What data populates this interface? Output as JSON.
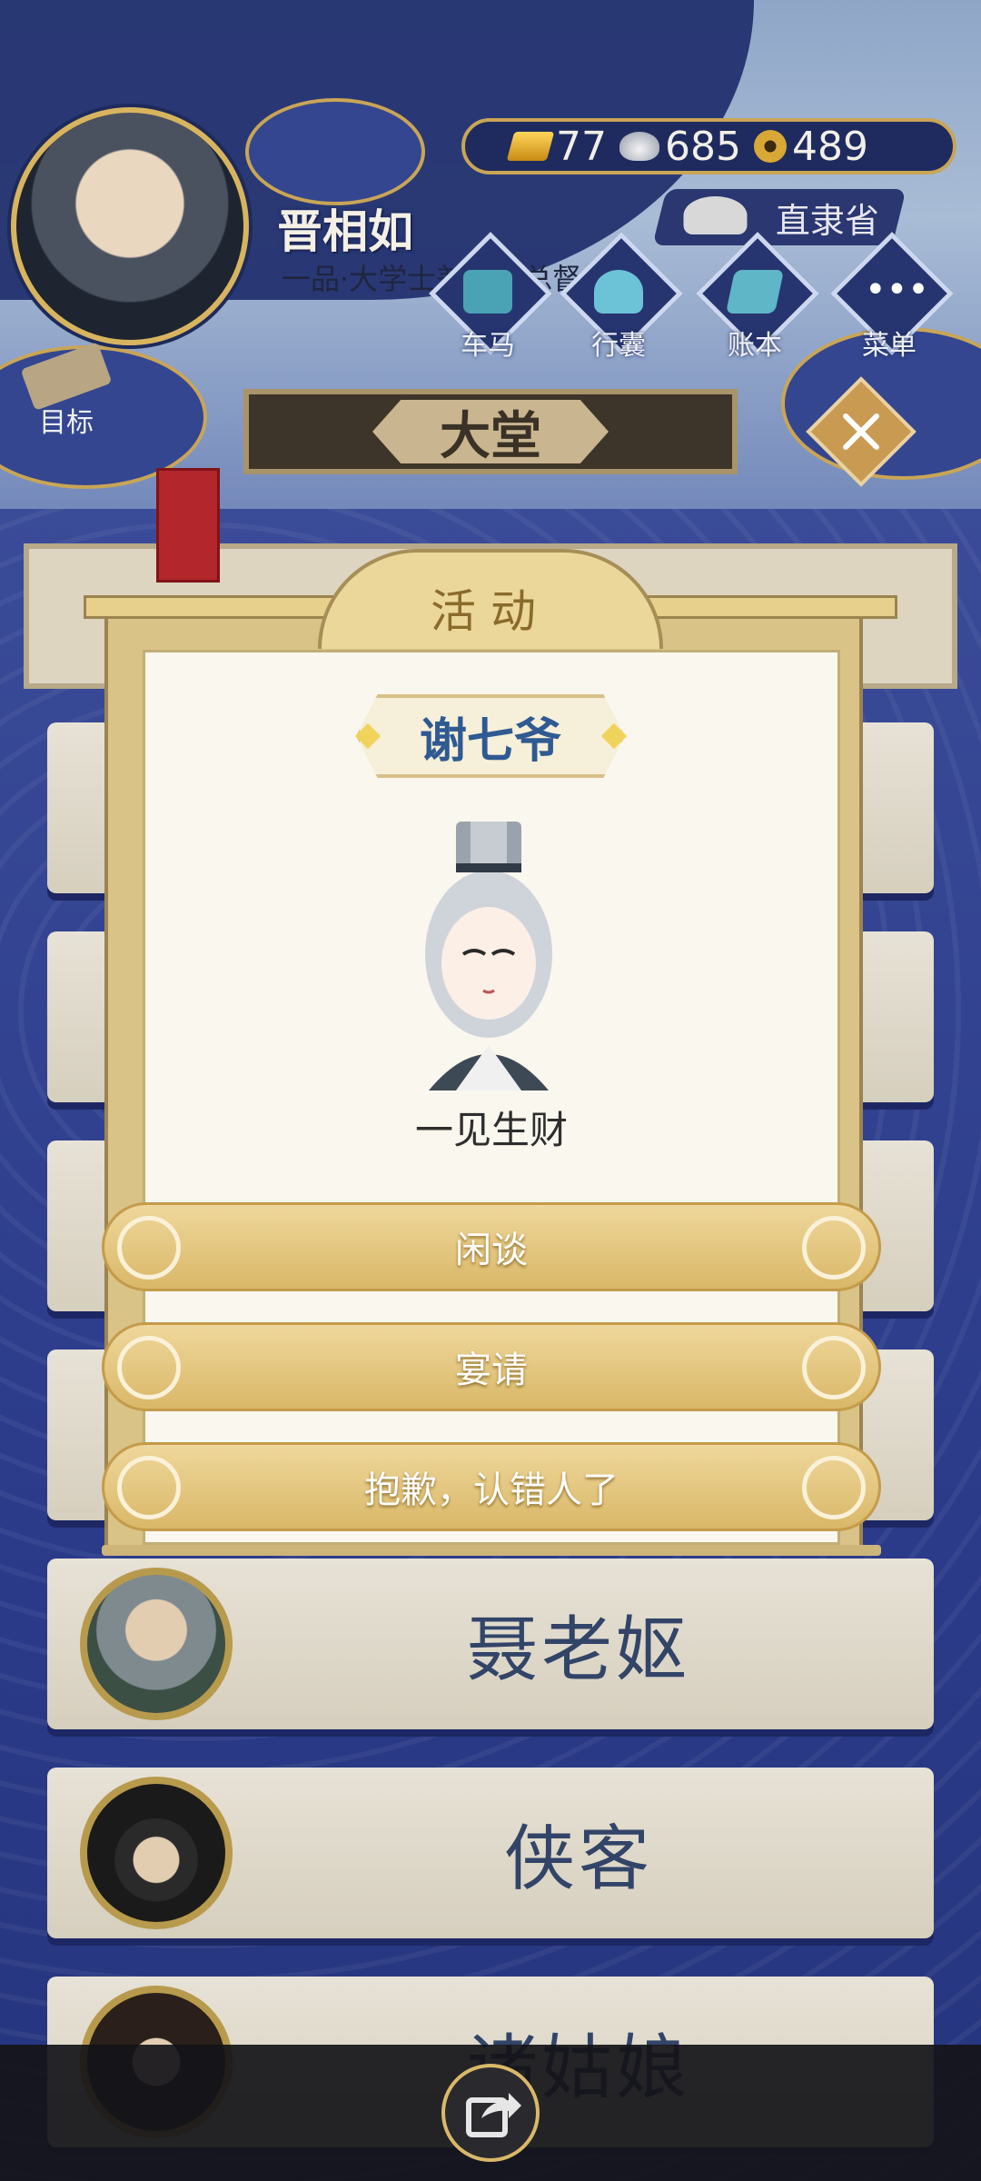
{
  "player": {
    "name": "晋相如",
    "title": "一品·大学士兼直隶总督"
  },
  "currencies": {
    "gold": "77",
    "silver": "685",
    "coins": "489"
  },
  "region": "直隶省",
  "menu": [
    {
      "label": "车马",
      "icon": "carriage-icon"
    },
    {
      "label": "行囊",
      "icon": "bundle-icon"
    },
    {
      "label": "账本",
      "icon": "ledger-icon"
    },
    {
      "label": "菜单",
      "icon": "more-icon"
    }
  ],
  "goal_label": "目标",
  "hall_title": "大堂",
  "dialog": {
    "header": "活动",
    "npc_name": "谢七爷",
    "npc_desc": "一见生财",
    "options": [
      "闲谈",
      "宴请",
      "抱歉，认错人了"
    ]
  },
  "npc_list": [
    "聂老妪",
    "侠客",
    "诸姑娘"
  ],
  "colors": {
    "navy": "#2c3d86",
    "gold_border": "#c9a556",
    "option_gold": "#d9b868",
    "name_blue": "#2f5a92"
  }
}
